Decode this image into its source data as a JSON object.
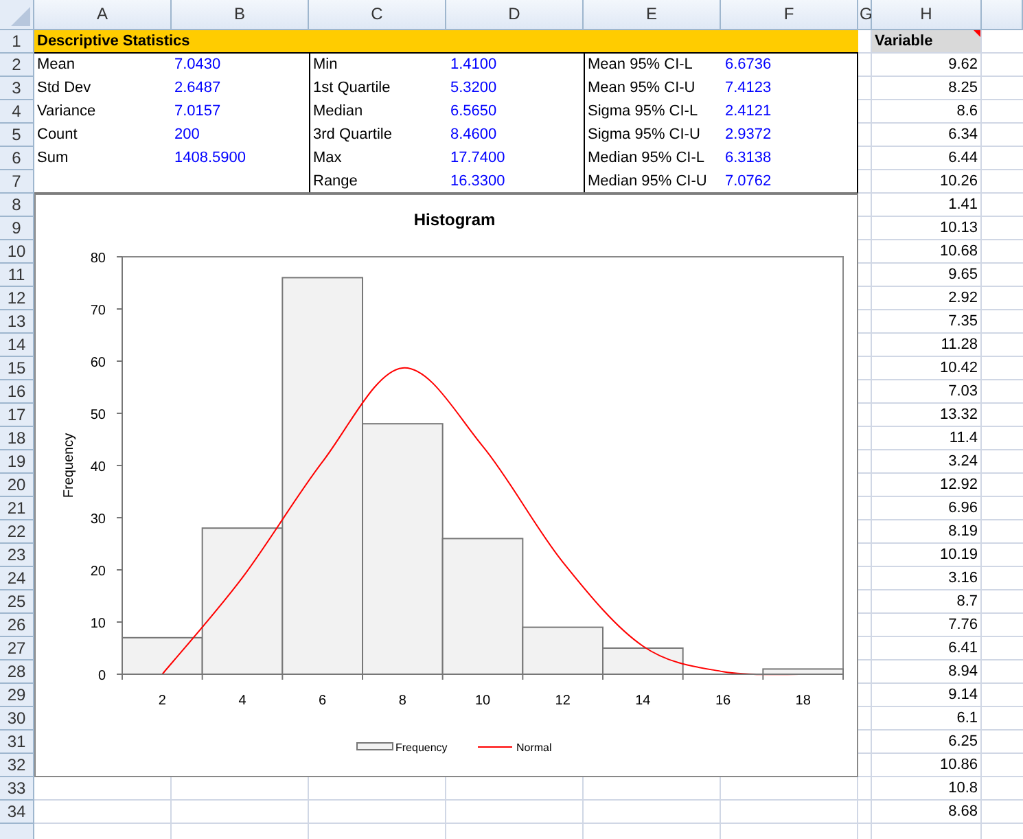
{
  "columns": [
    "A",
    "B",
    "C",
    "D",
    "E",
    "F",
    "G",
    "H"
  ],
  "rows": [
    "1",
    "2",
    "3",
    "4",
    "5",
    "6",
    "7",
    "8",
    "9",
    "10",
    "11",
    "12",
    "13",
    "14",
    "15",
    "16",
    "17",
    "18",
    "19",
    "20",
    "21",
    "22",
    "23",
    "24",
    "25",
    "26",
    "27",
    "28",
    "29",
    "30",
    "31",
    "32",
    "33",
    "34"
  ],
  "stats": {
    "title": "Descriptive Statistics",
    "groups": [
      {
        "items": [
          {
            "label": "Mean",
            "value": "7.0430"
          },
          {
            "label": "Std Dev",
            "value": "2.6487"
          },
          {
            "label": "Variance",
            "value": "7.0157"
          },
          {
            "label": "Count",
            "value": "200"
          },
          {
            "label": "Sum",
            "value": "1408.5900"
          }
        ]
      },
      {
        "items": [
          {
            "label": "Min",
            "value": "1.4100"
          },
          {
            "label": "1st Quartile",
            "value": "5.3200"
          },
          {
            "label": "Median",
            "value": "6.5650"
          },
          {
            "label": "3rd Quartile",
            "value": "8.4600"
          },
          {
            "label": "Max",
            "value": "17.7400"
          },
          {
            "label": "Range",
            "value": "16.3300"
          }
        ]
      },
      {
        "items": [
          {
            "label": "Mean 95% CI-L",
            "value": "6.6736"
          },
          {
            "label": "Mean 95% CI-U",
            "value": "7.4123"
          },
          {
            "label": "Sigma 95% CI-L",
            "value": "2.4121"
          },
          {
            "label": "Sigma 95% CI-U",
            "value": "2.9372"
          },
          {
            "label": "Median 95% CI-L",
            "value": "6.3138"
          },
          {
            "label": "Median 95% CI-U",
            "value": "7.0762"
          }
        ]
      }
    ]
  },
  "variable": {
    "header": "Variable",
    "has_comment": true,
    "values": [
      "9.62",
      "8.25",
      "8.6",
      "6.34",
      "6.44",
      "10.26",
      "1.41",
      "10.13",
      "10.68",
      "9.65",
      "2.92",
      "7.35",
      "11.28",
      "10.42",
      "7.03",
      "13.32",
      "11.4",
      "3.24",
      "12.92",
      "6.96",
      "8.19",
      "10.19",
      "3.16",
      "8.7",
      "7.76",
      "6.41",
      "8.94",
      "9.14",
      "6.1",
      "6.25",
      "10.86",
      "10.8",
      "8.68"
    ]
  },
  "chart_data": {
    "type": "bar",
    "title": "Histogram",
    "ylabel": "Frequency",
    "categories": [
      "2",
      "4",
      "6",
      "8",
      "10",
      "12",
      "14",
      "16",
      "18"
    ],
    "ylim": [
      0,
      80
    ],
    "yticks": [
      0,
      10,
      20,
      30,
      40,
      50,
      60,
      70,
      80
    ],
    "legend": true,
    "series": [
      {
        "name": "Frequency",
        "type": "bar",
        "color": "#f2f2f2",
        "values": [
          7,
          28,
          76,
          48,
          26,
          9,
          5,
          0,
          1
        ]
      },
      {
        "name": "Normal",
        "type": "line",
        "color": "#ff0000",
        "values": [
          0,
          18.5,
          40.7,
          58.7,
          43.7,
          21.5,
          5.4,
          0.5,
          0
        ]
      }
    ]
  }
}
